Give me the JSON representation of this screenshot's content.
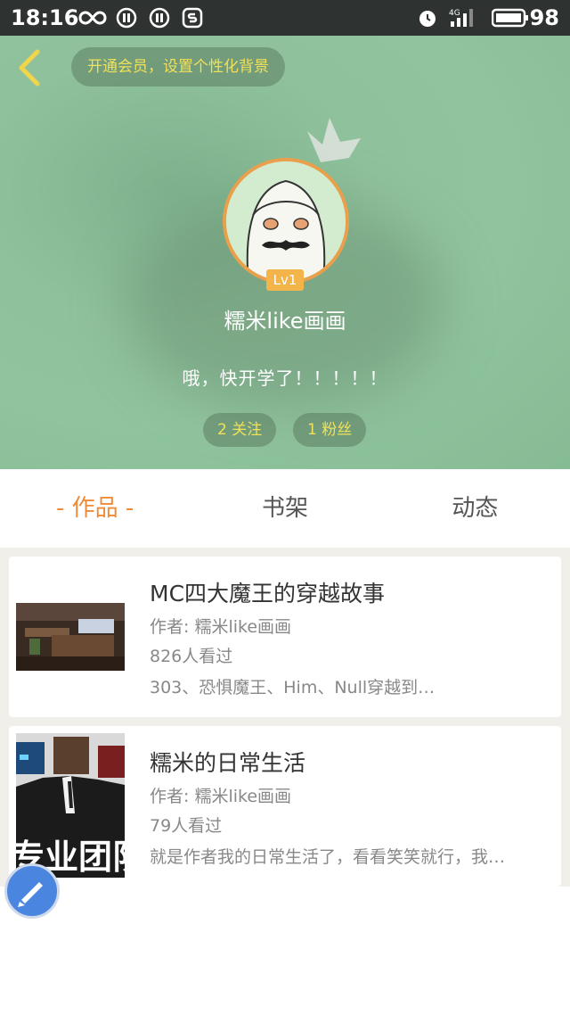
{
  "status_bar": {
    "time": "18:16",
    "battery": "98",
    "icons": [
      "infinity-icon",
      "pause-icon",
      "pause-icon",
      "app-icon",
      "alarm-icon",
      "signal-4g-icon",
      "battery-icon"
    ]
  },
  "header": {
    "vip_banner": "开通会员，设置个性化背景",
    "level": "Lv1",
    "nickname": "糯米like画画",
    "bio": "哦，快开学了！！！！！",
    "following": "2 关注",
    "followers": "1 粉丝"
  },
  "tabs": [
    {
      "label": "- 作品 -",
      "active": true
    },
    {
      "label": "书架",
      "active": false
    },
    {
      "label": "动态",
      "active": false
    }
  ],
  "works": [
    {
      "title": "MC四大魔王的穿越故事",
      "author": "作者: 糯米like画画",
      "views": "826人看过",
      "summary": "303、恐惧魔王、Him、Null穿越到…"
    },
    {
      "title": "糯米的日常生活",
      "author": "作者: 糯米like画画",
      "views": "79人看过",
      "summary": "就是作者我的日常生活了，看看笑笑就行，我…",
      "thumb_caption": "专业团队"
    }
  ],
  "colors": {
    "accent": "#ee8b3a",
    "header_green": "#8fc29c",
    "pill_text": "#f1e05a",
    "fab_blue": "#4a86e0"
  }
}
